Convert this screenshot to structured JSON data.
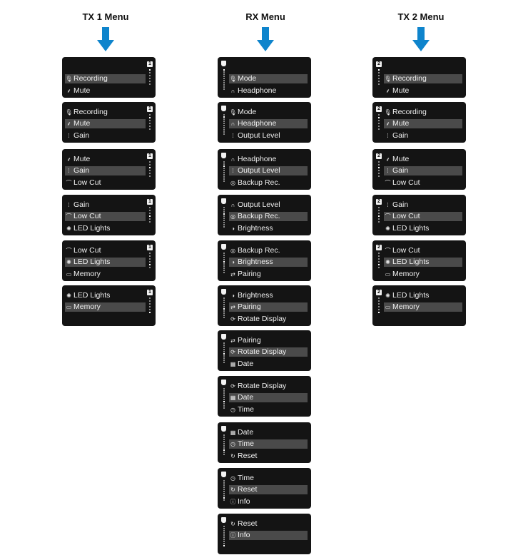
{
  "colors": {
    "arrow": "#0e84cc",
    "panel_bg": "#141414",
    "selected_bg": "#4a4a4a",
    "text": "#f0f0f0"
  },
  "columns": [
    {
      "title": "TX 1 Menu",
      "badge": "1",
      "indicator": "number",
      "screens": [
        {
          "rows": [
            null,
            {
              "icon": "🎙",
              "label": "Recording"
            },
            {
              "icon": "⸙",
              "label": "Mute"
            }
          ],
          "selected": 1,
          "position": 1,
          "total": 6
        },
        {
          "rows": [
            {
              "icon": "🎙",
              "label": "Recording"
            },
            {
              "icon": "⸙",
              "label": "Mute"
            },
            {
              "icon": "⁞",
              "label": "Gain"
            }
          ],
          "selected": 1,
          "position": 2,
          "total": 6
        },
        {
          "rows": [
            {
              "icon": "⸙",
              "label": "Mute"
            },
            {
              "icon": "⁞",
              "label": "Gain"
            },
            {
              "icon": "⌒",
              "label": "Low Cut"
            }
          ],
          "selected": 1,
          "position": 3,
          "total": 6
        },
        {
          "rows": [
            {
              "icon": "⁞",
              "label": "Gain"
            },
            {
              "icon": "⌒",
              "label": "Low Cut"
            },
            {
              "icon": "✺",
              "label": "LED Lights"
            }
          ],
          "selected": 1,
          "position": 4,
          "total": 6
        },
        {
          "rows": [
            {
              "icon": "⌒",
              "label": "Low Cut"
            },
            {
              "icon": "✺",
              "label": "LED Lights"
            },
            {
              "icon": "▭",
              "label": "Memory"
            }
          ],
          "selected": 1,
          "position": 5,
          "total": 6
        },
        {
          "rows": [
            {
              "icon": "✺",
              "label": "LED Lights"
            },
            {
              "icon": "▭",
              "label": "Memory"
            },
            null
          ],
          "selected": 1,
          "position": 6,
          "total": 6
        }
      ]
    },
    {
      "title": "RX Menu",
      "badge": "",
      "indicator": "shield",
      "screens": [
        {
          "rows": [
            null,
            {
              "icon": "🎙",
              "label": "Mode"
            },
            {
              "icon": "∩",
              "label": "Headphone"
            }
          ],
          "selected": 1,
          "position": 1,
          "total": 11
        },
        {
          "rows": [
            {
              "icon": "🎙",
              "label": "Mode"
            },
            {
              "icon": "∩",
              "label": "Headphone"
            },
            {
              "icon": "⁞",
              "label": "Output Level"
            }
          ],
          "selected": 1,
          "position": 2,
          "total": 11
        },
        {
          "rows": [
            {
              "icon": "∩",
              "label": "Headphone"
            },
            {
              "icon": "⁞",
              "label": "Output Level"
            },
            {
              "icon": "◎",
              "label": "Backup Rec."
            }
          ],
          "selected": 1,
          "position": 3,
          "total": 11
        },
        {
          "rows": [
            {
              "icon": "∩",
              "label": "Output Level"
            },
            {
              "icon": "◎",
              "label": "Backup Rec."
            },
            {
              "icon": "◑",
              "label": "Brightness"
            }
          ],
          "selected": 1,
          "position": 4,
          "total": 11
        },
        {
          "rows": [
            {
              "icon": "◎",
              "label": "Backup Rec."
            },
            {
              "icon": "◑",
              "label": "Brightness"
            },
            {
              "icon": "⇄",
              "label": "Pairing"
            }
          ],
          "selected": 1,
          "position": 5,
          "total": 11
        },
        {
          "rows": [
            {
              "icon": "◑",
              "label": "Brightness"
            },
            {
              "icon": "⇄",
              "label": "Pairing"
            },
            {
              "icon": "⟳",
              "label": "Rotate Display"
            }
          ],
          "selected": 1,
          "position": 6,
          "total": 11
        },
        {
          "rows": [
            {
              "icon": "⇄",
              "label": "Pairing"
            },
            {
              "icon": "⟳",
              "label": "Rotate Display"
            },
            {
              "icon": "▦",
              "label": "Date"
            }
          ],
          "selected": 1,
          "position": 7,
          "total": 11
        },
        {
          "rows": [
            {
              "icon": "⟳",
              "label": "Rotate Display"
            },
            {
              "icon": "▦",
              "label": "Date"
            },
            {
              "icon": "◷",
              "label": "Time"
            }
          ],
          "selected": 1,
          "position": 8,
          "total": 11
        },
        {
          "rows": [
            {
              "icon": "▦",
              "label": "Date"
            },
            {
              "icon": "◷",
              "label": "Time"
            },
            {
              "icon": "↻",
              "label": "Reset"
            }
          ],
          "selected": 1,
          "position": 9,
          "total": 11
        },
        {
          "rows": [
            {
              "icon": "◷",
              "label": "Time"
            },
            {
              "icon": "↻",
              "label": "Reset"
            },
            {
              "icon": "ⓘ",
              "label": "Info"
            }
          ],
          "selected": 1,
          "position": 10,
          "total": 11
        },
        {
          "rows": [
            {
              "icon": "↻",
              "label": "Reset"
            },
            {
              "icon": "ⓘ",
              "label": "Info"
            },
            null
          ],
          "selected": 1,
          "position": 11,
          "total": 11
        }
      ]
    },
    {
      "title": "TX 2 Menu",
      "badge": "2",
      "indicator": "number-left",
      "screens": [
        {
          "rows": [
            null,
            {
              "icon": "🎙",
              "label": "Recording"
            },
            {
              "icon": "⸙",
              "label": "Mute"
            }
          ],
          "selected": 1,
          "position": 1,
          "total": 6
        },
        {
          "rows": [
            {
              "icon": "🎙",
              "label": "Recording"
            },
            {
              "icon": "⸙",
              "label": "Mute"
            },
            {
              "icon": "⁞",
              "label": "Gain"
            }
          ],
          "selected": 1,
          "position": 2,
          "total": 6
        },
        {
          "rows": [
            {
              "icon": "⸙",
              "label": "Mute"
            },
            {
              "icon": "⁞",
              "label": "Gain"
            },
            {
              "icon": "⌒",
              "label": "Low Cut"
            }
          ],
          "selected": 1,
          "position": 3,
          "total": 6
        },
        {
          "rows": [
            {
              "icon": "⁞",
              "label": "Gain"
            },
            {
              "icon": "⌒",
              "label": "Low Cut"
            },
            {
              "icon": "✺",
              "label": "LED Lights"
            }
          ],
          "selected": 1,
          "position": 4,
          "total": 6
        },
        {
          "rows": [
            {
              "icon": "⌒",
              "label": "Low Cut"
            },
            {
              "icon": "✺",
              "label": "LED Lights"
            },
            {
              "icon": "▭",
              "label": "Memory"
            }
          ],
          "selected": 1,
          "position": 5,
          "total": 6
        },
        {
          "rows": [
            {
              "icon": "✺",
              "label": "LED Lights"
            },
            {
              "icon": "▭",
              "label": "Memory"
            },
            null
          ],
          "selected": 1,
          "position": 6,
          "total": 6
        }
      ]
    }
  ]
}
